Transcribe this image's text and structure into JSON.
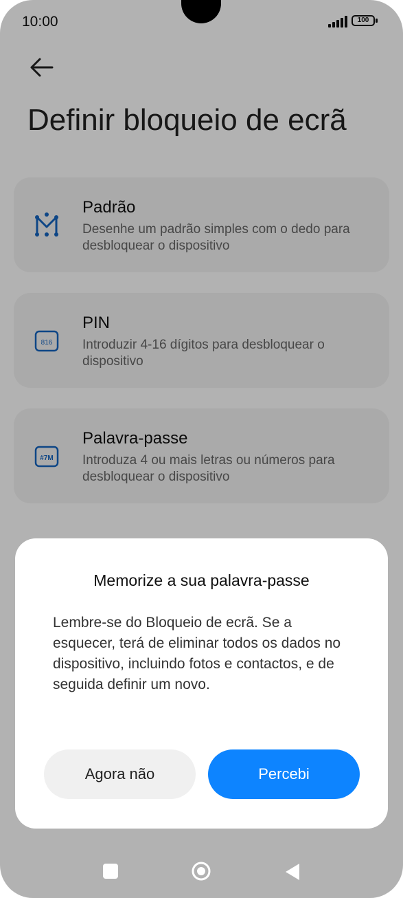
{
  "status_bar": {
    "time": "10:00",
    "battery": "100"
  },
  "page": {
    "title": "Definir bloqueio de ecrã"
  },
  "options": [
    {
      "title": "Padrão",
      "description": "Desenhe um padrão simples com o dedo para desbloquear o dispositivo",
      "icon": "pattern-icon"
    },
    {
      "title": "PIN",
      "description": "Introduzir 4-16 dígitos para desbloquear o dispositivo",
      "icon": "pin-icon",
      "icon_text": "816"
    },
    {
      "title": "Palavra-passe",
      "description": "Introduza 4 ou mais letras ou números para desbloquear o dispositivo",
      "icon": "password-icon",
      "icon_text": "#7M"
    }
  ],
  "dialog": {
    "title": "Memorize a sua palavra-passe",
    "body": "Lembre-se do Bloqueio de ecrã. Se a esquecer, terá de eliminar todos os dados no dispositivo, incluindo fotos e contactos, e de seguida definir um novo.",
    "secondary_button": "Agora não",
    "primary_button": "Percebi"
  },
  "colors": {
    "accent": "#0d84ff",
    "icon_blue": "#1565c0",
    "scrim": "rgba(0,0,0,0.30)"
  }
}
